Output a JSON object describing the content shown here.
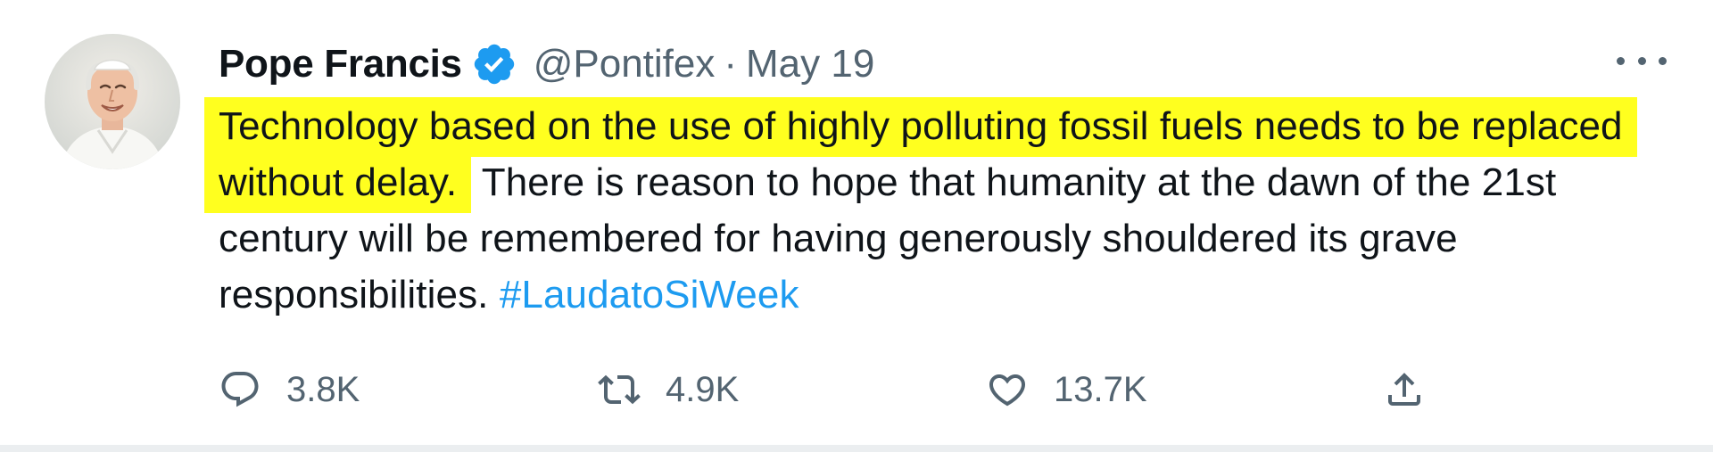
{
  "user": {
    "display_name": "Pope Francis",
    "handle": "@Pontifex",
    "separator": "·",
    "date": "May 19",
    "verified": true,
    "avatar_icon": "portrait-avatar"
  },
  "tweet": {
    "highlighted_text": "Technology based on the use of highly polluting fossil fuels needs to be replaced without delay.",
    "rest_text": " There is reason to hope that humanity at the dawn of the 21st century will be remembered for having generously shouldered its grave responsibilities. ",
    "hashtag": "#LaudatoSiWeek"
  },
  "actions": {
    "reply": {
      "icon": "reply-icon",
      "count": "3.8K"
    },
    "retweet": {
      "icon": "retweet-icon",
      "count": "4.9K"
    },
    "like": {
      "icon": "heart-icon",
      "count": "13.7K"
    },
    "share": {
      "icon": "share-icon"
    }
  },
  "colors": {
    "highlight": "#ffff1f",
    "link": "#1d9bf0",
    "verified": "#1d9bf0",
    "secondary_text": "#536471"
  }
}
